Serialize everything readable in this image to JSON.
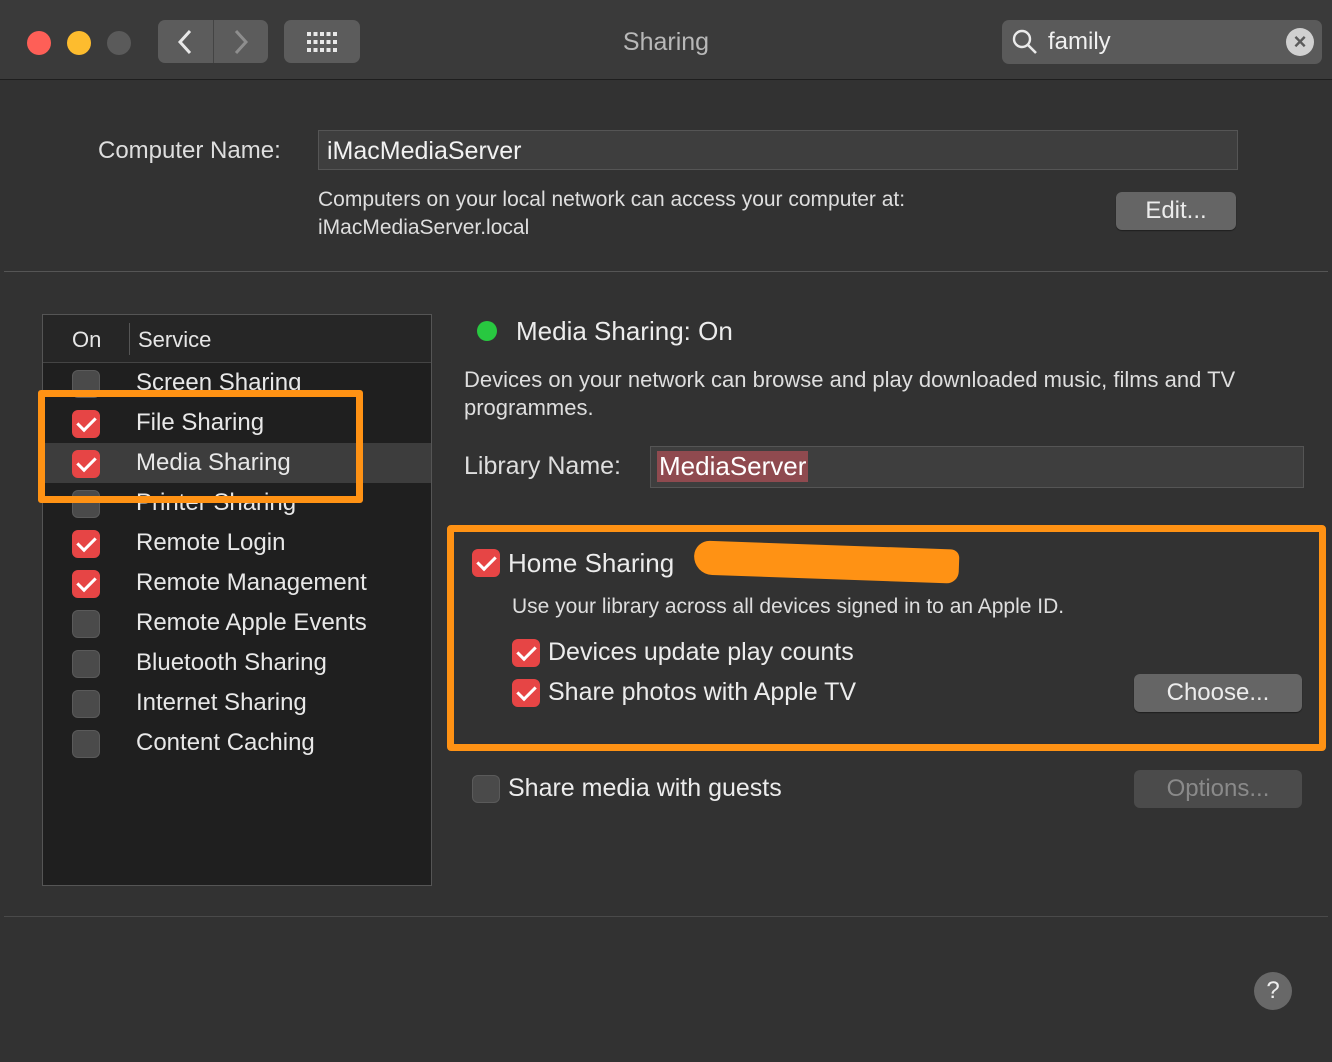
{
  "window": {
    "title": "Sharing",
    "search_value": "family",
    "traffic_colors": {
      "close": "#fe5f57",
      "minimize": "#fdbc2e",
      "zoom": "#5a5a5a"
    }
  },
  "computer": {
    "label": "Computer Name:",
    "value": "iMacMediaServer",
    "desc_line1": "Computers on your local network can access your computer at:",
    "desc_line2": "iMacMediaServer.local",
    "edit_label": "Edit..."
  },
  "services": {
    "col_on": "On",
    "col_service": "Service",
    "items": [
      {
        "label": "Screen Sharing",
        "checked": false
      },
      {
        "label": "File Sharing",
        "checked": true
      },
      {
        "label": "Media Sharing",
        "checked": true,
        "selected": true
      },
      {
        "label": "Printer Sharing",
        "checked": false
      },
      {
        "label": "Remote Login",
        "checked": true
      },
      {
        "label": "Remote Management",
        "checked": true
      },
      {
        "label": "Remote Apple Events",
        "checked": false
      },
      {
        "label": "Bluetooth Sharing",
        "checked": false
      },
      {
        "label": "Internet Sharing",
        "checked": false
      },
      {
        "label": "Content Caching",
        "checked": false
      }
    ]
  },
  "media": {
    "status": "Media Sharing: On",
    "status_color": "#28c840",
    "description": "Devices on your network can browse and play downloaded music, films and TV programmes.",
    "library_label": "Library Name:",
    "library_value": "MediaServer",
    "home_sharing_label": "Home Sharing",
    "home_sharing_desc": "Use your library across all devices signed in to an Apple ID.",
    "opt_play_counts": "Devices update play counts",
    "opt_photos": "Share photos with Apple TV",
    "choose_label": "Choose...",
    "guests_label": "Share media with guests",
    "options_label": "Options..."
  },
  "colors": {
    "accent_checkbox": "#e64545",
    "highlight": "#ff9214"
  }
}
